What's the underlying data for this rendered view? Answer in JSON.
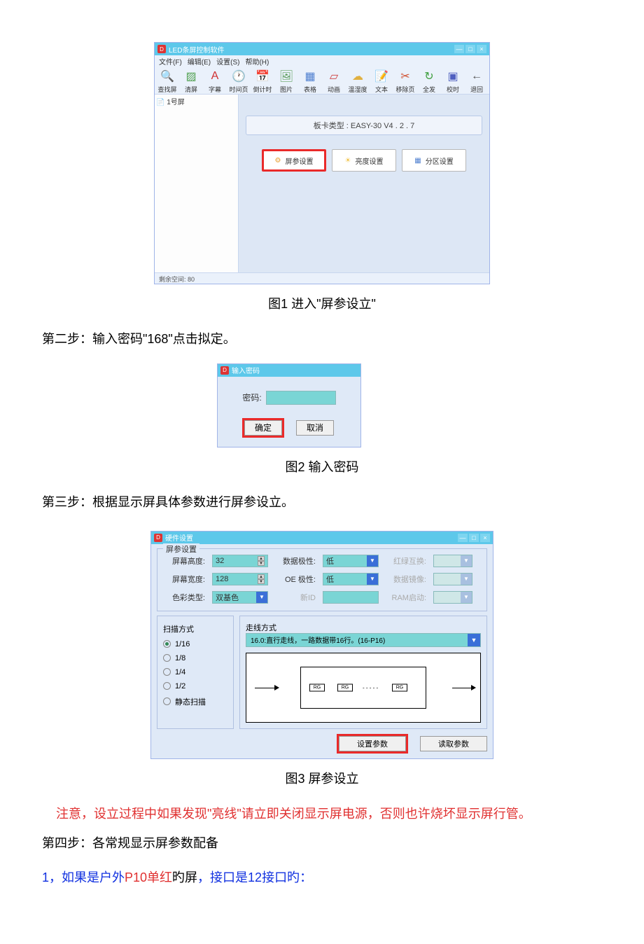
{
  "fig1": {
    "title": "LED条屏控制软件",
    "menus": [
      "文件(F)",
      "编辑(E)",
      "设置(S)",
      "帮助(H)"
    ],
    "toolbar": [
      {
        "label": "查找屏",
        "glyph": "🔍",
        "color": "#e8b030"
      },
      {
        "label": "清屏",
        "glyph": "▨",
        "color": "#50a050"
      },
      {
        "label": "字幕",
        "glyph": "A",
        "color": "#d03030"
      },
      {
        "label": "时间页",
        "glyph": "🕐",
        "color": "#888"
      },
      {
        "label": "倒计时",
        "glyph": "📅",
        "color": "#4070d0"
      },
      {
        "label": "图片",
        "glyph": "🖼",
        "color": "#60a060"
      },
      {
        "label": "表格",
        "glyph": "▦",
        "color": "#5080d0"
      },
      {
        "label": "动画",
        "glyph": "▱",
        "color": "#d04040"
      },
      {
        "label": "温湿度",
        "glyph": "☁",
        "color": "#e0b040"
      },
      {
        "label": "文本",
        "glyph": "📝",
        "color": "#5090d0"
      },
      {
        "label": "移除页",
        "glyph": "✂",
        "color": "#d05030"
      },
      {
        "label": "全发",
        "glyph": "↻",
        "color": "#40a040"
      },
      {
        "label": "校时",
        "glyph": "▣",
        "color": "#5060c0"
      },
      {
        "label": "退回",
        "glyph": "←",
        "color": "#555"
      }
    ],
    "tree_item": "1号屏",
    "board_type": "板卡类型 : EASY-30 V4 . 2 . 7",
    "btn_screen_param": "屏参设置",
    "btn_brightness": "亮度设置",
    "btn_area": "分区设置",
    "status": "剩余空间: 80"
  },
  "caption1": "图1 进入\"屏参设立\"",
  "step2": "第二步：输入密码\"168\"点击拟定。",
  "fig2": {
    "title": "输入密码",
    "label": "密码:",
    "ok": "确定",
    "cancel": "取消"
  },
  "caption2": "图2   输入密码",
  "step3": "第三步：根据显示屏具体参数进行屏参设立。",
  "fig3": {
    "title": "硬件设置",
    "fs_param": "屏参设置",
    "lbl_height": "屏幕高度:",
    "val_height": "32",
    "lbl_width": "屏幕宽度:",
    "val_width": "128",
    "lbl_color": "色彩类型:",
    "val_color": "双基色",
    "lbl_datapol": "数据极性:",
    "val_datapol": "低",
    "lbl_oe": "OE 极性:",
    "val_oe": "低",
    "lbl_newid": "新ID",
    "lbl_rgswap": "红绿互换:",
    "lbl_mirror": "数据镜像:",
    "lbl_ram": "RAM启动:",
    "fs_scan": "扫描方式",
    "scan_opts": [
      "1/16",
      "1/8",
      "1/4",
      "1/2",
      "静态扫描"
    ],
    "fs_route": "走线方式",
    "route_val": "16.0:直行走线，一路数据带16行。(16-P16)",
    "rg": "RG",
    "btn_set": "设置参数",
    "btn_read": "读取参数"
  },
  "caption3": "图3    屏参设立",
  "warning": "注意，设立过程中如果发现\"亮线\"请立即关闭显示屏电源，否则也许烧坏显示屏行管。",
  "step4": "第四步：各常规显示屏参数配备",
  "step4_note_blue1": "1，如果是户外",
  "step4_note_red": "P10单红",
  "step4_note_black": "旳屏",
  "step4_note_blue2": "，接口是12接口旳："
}
